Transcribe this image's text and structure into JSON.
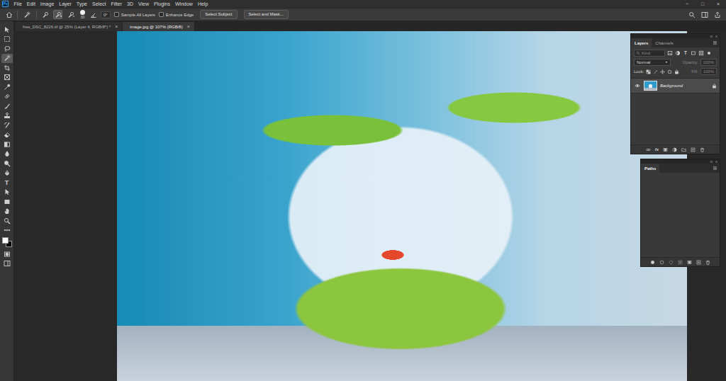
{
  "app": {
    "logo": "Ps"
  },
  "menu": [
    "File",
    "Edit",
    "Image",
    "Layer",
    "Type",
    "Select",
    "Filter",
    "3D",
    "View",
    "Plugins",
    "Window",
    "Help"
  ],
  "window_controls": [
    "−",
    "□",
    "×"
  ],
  "options": {
    "brush_modes": [
      {
        "selected": false
      },
      {
        "selected": true
      },
      {
        "selected": false
      }
    ],
    "brush_size": "30",
    "angle": "0°",
    "checkboxes": [
      {
        "label": "Sample All Layers",
        "checked": false
      },
      {
        "label": "Enhance Edge",
        "checked": false
      }
    ],
    "buttons": [
      "Select Subject",
      "Select and Mask..."
    ]
  },
  "tabs": [
    {
      "label": "free_DSC_8226.tif @ 25% (Layer 4, RGB/8*) *",
      "close": "×",
      "selected": false
    },
    {
      "label": "image.jpg @ 107% (RGB/8)",
      "close": "×",
      "selected": true
    }
  ],
  "tools": [
    {
      "kind": "icon",
      "selected": false
    },
    {
      "kind": "icon",
      "selected": false
    },
    {
      "kind": "icon",
      "selected": false
    },
    {
      "kind": "icon",
      "selected": true
    },
    {
      "kind": "icon",
      "selected": false
    },
    {
      "kind": "icon",
      "selected": false
    },
    {
      "kind": "icon",
      "selected": false
    },
    {
      "kind": "icon",
      "selected": false
    },
    {
      "kind": "icon",
      "selected": false
    },
    {
      "kind": "icon",
      "selected": false
    },
    {
      "kind": "icon",
      "selected": false
    },
    {
      "kind": "icon",
      "selected": false
    },
    {
      "kind": "icon",
      "selected": false
    },
    {
      "kind": "icon",
      "selected": false
    },
    {
      "kind": "icon",
      "selected": false
    },
    {
      "kind": "icon",
      "selected": false
    },
    {
      "kind": "glyph",
      "glyph": "T",
      "selected": false
    },
    {
      "kind": "icon",
      "selected": false
    },
    {
      "kind": "icon",
      "selected": false
    },
    {
      "kind": "icon",
      "selected": false
    },
    {
      "kind": "icon",
      "selected": false
    },
    {
      "kind": "icon",
      "selected": false
    }
  ],
  "colors": {
    "foreground": "#ffffff",
    "background": "#000000"
  },
  "layers_panel": {
    "tabs": [
      {
        "label": "Layers",
        "selected": true
      },
      {
        "label": "Channels",
        "selected": false
      }
    ],
    "filter": {
      "placeholder": "Kind",
      "type_glyph": "T"
    },
    "blend_mode": "Normal",
    "opacity": {
      "label": "Opacity:",
      "value": "100%",
      "disabled": true
    },
    "lock_label": "Lock:",
    "fill": {
      "label": "Fill:",
      "value": "100%",
      "disabled": true
    },
    "layers": [
      {
        "name": "Background",
        "visible": true,
        "locked": true,
        "selected": true
      }
    ],
    "footer_fx": "fx"
  },
  "paths_panel": {
    "tabs": [
      {
        "label": "Paths",
        "selected": true
      }
    ]
  }
}
